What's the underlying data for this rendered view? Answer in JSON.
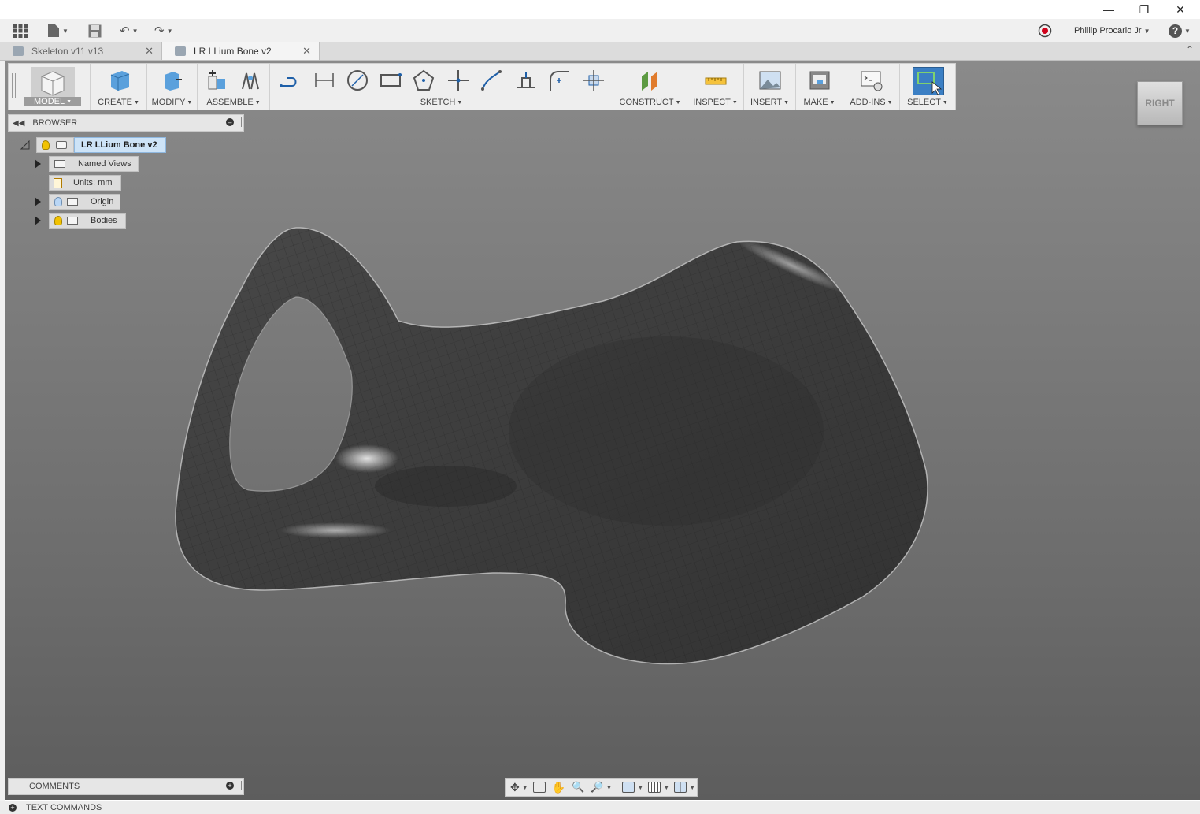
{
  "window": {
    "minimize_icon": "minimize-icon",
    "restore_icon": "restore-icon",
    "close_icon": "close-icon"
  },
  "quick_access": {
    "user_name": "Phillip Procario Jr",
    "help_label": "?"
  },
  "tabs": [
    {
      "label": "Skeleton v11 v13",
      "active": false
    },
    {
      "label": "LR LLium Bone v2",
      "active": true
    }
  ],
  "toolbar": {
    "workspace": "MODEL",
    "create": "CREATE",
    "modify": "MODIFY",
    "assemble": "ASSEMBLE",
    "sketch": "SKETCH",
    "construct": "CONSTRUCT",
    "inspect": "INSPECT",
    "insert": "INSERT",
    "make": "MAKE",
    "addins": "ADD-INS",
    "select": "SELECT"
  },
  "browser": {
    "title": "BROWSER",
    "root": "LR LLium Bone v2",
    "items": [
      {
        "label": "Named Views"
      },
      {
        "label": "Units: mm"
      },
      {
        "label": "Origin"
      },
      {
        "label": "Bodies"
      }
    ]
  },
  "viewcube": {
    "face": "RIGHT"
  },
  "comments": {
    "title": "COMMENTS"
  },
  "text_commands": {
    "title": "TEXT COMMANDS"
  },
  "colors": {
    "accent": "#3b7fc4",
    "viewport_top": "#8a8a8a",
    "viewport_bottom": "#5d5d5d",
    "mesh": "#3a3a3a"
  }
}
